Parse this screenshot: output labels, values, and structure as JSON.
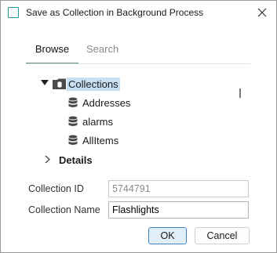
{
  "dialog": {
    "title": "Save as Collection in Background Process",
    "close_glyph": "×"
  },
  "tabs": [
    {
      "label": "Browse",
      "active": true
    },
    {
      "label": "Search",
      "active": false
    }
  ],
  "tree": {
    "root": {
      "label": "Collections",
      "icon": "database-folder-icon",
      "expanded": true,
      "selected": true
    },
    "children": [
      {
        "label": "Addresses",
        "icon": "database-icon"
      },
      {
        "label": "alarms",
        "icon": "database-icon"
      },
      {
        "label": "AllItems",
        "icon": "database-icon"
      }
    ],
    "details": {
      "label": "Details",
      "expanded": false
    }
  },
  "form": {
    "collection_id_label": "Collection ID",
    "collection_id_value": "5744791",
    "collection_name_label": "Collection Name",
    "collection_name_value": "Flashlights"
  },
  "buttons": {
    "ok_label": "OK",
    "cancel_label": "Cancel"
  },
  "colors": {
    "accent": "#1f9e9e",
    "selection": "#c6dff3",
    "ok_border": "#3f86c6"
  }
}
